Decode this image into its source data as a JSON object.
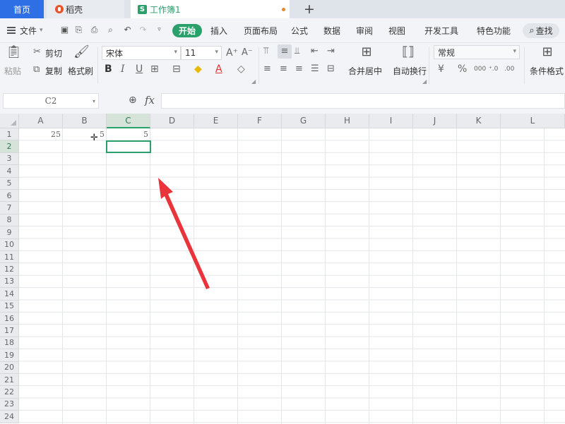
{
  "tabs": {
    "home": "首页",
    "daoke": "稻壳",
    "workbook": "工作簿1",
    "new_tab": "+"
  },
  "menu": {
    "file": "文件",
    "start": "开始",
    "items": [
      "插入",
      "页面布局",
      "公式",
      "数据",
      "审阅",
      "视图",
      "开发工具",
      "特色功能"
    ],
    "search": "查找"
  },
  "ribbon": {
    "paste": "粘贴",
    "cut": "剪切",
    "copy": "复制",
    "format_painter": "格式刷",
    "font_name": "宋体",
    "font_size": "11",
    "merge_center": "合并居中",
    "wrap_text": "自动换行",
    "number_format": "常规",
    "conditional_format": "条件格式"
  },
  "formula_bar": {
    "name_box": "C2",
    "fx": "fx",
    "formula": ""
  },
  "grid": {
    "columns": [
      "A",
      "B",
      "C",
      "D",
      "E",
      "F",
      "G",
      "H",
      "I",
      "J",
      "K",
      "L"
    ],
    "selected_column": "C",
    "rows": [
      "1",
      "2",
      "3",
      "4",
      "5",
      "6",
      "7",
      "8",
      "9",
      "10",
      "11",
      "12",
      "13",
      "14",
      "15",
      "16",
      "17",
      "18",
      "19",
      "20",
      "21",
      "22",
      "23",
      "24"
    ],
    "selected_row": "2",
    "cells": {
      "A1": "25",
      "B1": "5",
      "C1": "5"
    },
    "active_cell": "C2"
  },
  "colors": {
    "accent_green": "#2aa06a",
    "home_tab_blue": "#2f6fe5",
    "annotation_arrow": "#e8343a"
  }
}
